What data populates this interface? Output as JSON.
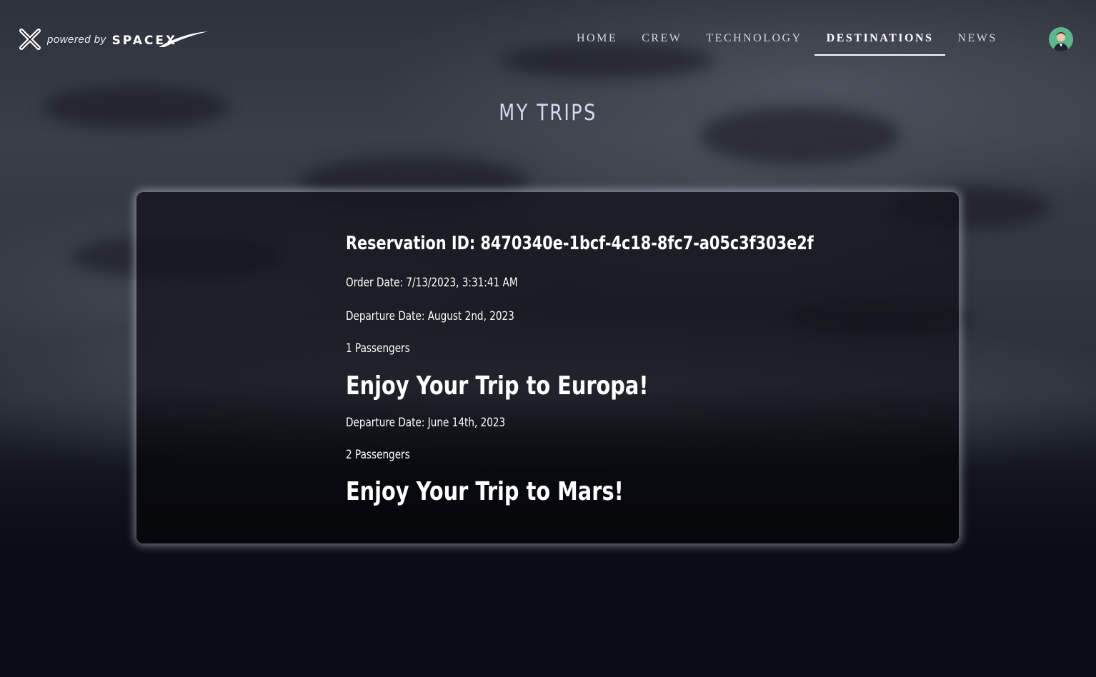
{
  "brand": {
    "powered_by": "powered by",
    "company": "SPACEX"
  },
  "nav": {
    "items": [
      {
        "label": "HOME"
      },
      {
        "label": "CREW"
      },
      {
        "label": "TECHNOLOGY"
      },
      {
        "label": "DESTINATIONS"
      },
      {
        "label": "NEWS"
      }
    ],
    "active": "DESTINATIONS"
  },
  "page": {
    "title": "MY TRIPS"
  },
  "reservation": {
    "id_text": "Reservation ID: 8470340e-1bcf-4c18-8fc7-a05c3f303e2f",
    "order_date": "Order Date: 7/13/2023, 3:31:41 AM",
    "trips": [
      {
        "departure": "Departure Date: August 2nd, 2023",
        "passengers": "1 Passengers",
        "message": "Enjoy Your Trip to Europa!"
      },
      {
        "departure": "Departure Date: June 14th, 2023",
        "passengers": "2 Passengers",
        "message": "Enjoy Your Trip to Mars!"
      }
    ]
  },
  "icons": {
    "logo": "x-logo-icon",
    "avatar": "user-avatar-icon"
  }
}
